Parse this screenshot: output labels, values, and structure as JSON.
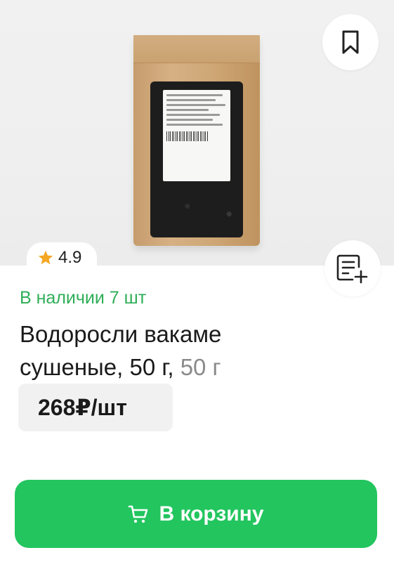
{
  "product": {
    "rating": "4.9",
    "availability": "В наличии 7 шт",
    "title": "Водоросли вакаме сушеные, 50 г,",
    "weight": "50 г",
    "price": "268₽/шт"
  },
  "actions": {
    "cart_label": "В корзину",
    "bookmark_icon": "bookmark-icon",
    "list_add_icon": "list-add-icon",
    "cart_icon": "cart-icon"
  },
  "colors": {
    "accent": "#22c55e",
    "availability": "#2fae57",
    "star": "#f5a623"
  }
}
